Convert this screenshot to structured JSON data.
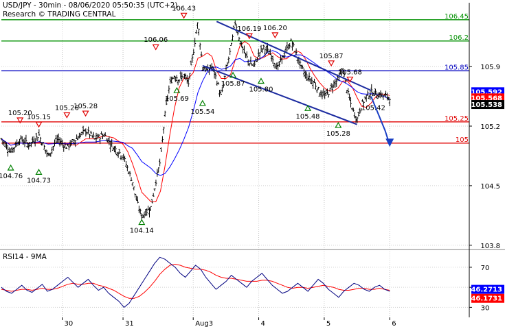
{
  "header": {
    "line1": "USD/JPY - 30min - 08/06/2020 05:50:35 (UTC+2)",
    "line2": "Research © TRADING CENTRAL"
  },
  "colors": {
    "support": "#e00000",
    "resistance": "#009000",
    "pivot": "#0000c0",
    "channel": "#1c2ba0",
    "forecast": "#1a3fc4",
    "ma_fast": "#ff0000",
    "ma_slow": "#0000ff",
    "rsi_line": "#000080",
    "rsi_ma": "#ff0000",
    "up_marker": "#008000",
    "down_marker": "#e00000"
  },
  "chart_data": [
    {
      "type": "candlestick",
      "title": "USD/JPY - 30min - 08/06/2020 05:50:35 (UTC+2)",
      "ylim": [
        103.75,
        106.65
      ],
      "y_ticks": [
        "106.45",
        "106.2",
        "105.9",
        "105.85",
        "105.592",
        "105.568",
        "105.538",
        "105.2",
        "105.25",
        "105",
        "104.5",
        "103.8"
      ],
      "x_ticks": [
        "30",
        "31",
        "Aug3",
        "4",
        "5",
        "6"
      ],
      "x_tick_positions": [
        0.13,
        0.26,
        0.41,
        0.55,
        0.69,
        0.83
      ],
      "levels": [
        {
          "value": 106.45,
          "label": "106.45",
          "role": "resistance"
        },
        {
          "value": 106.2,
          "label": "106.2",
          "role": "resistance"
        },
        {
          "value": 105.85,
          "label": "105.85",
          "role": "pivot"
        },
        {
          "value": 105.25,
          "label": "105.25",
          "role": "support"
        },
        {
          "value": 105,
          "label": "105",
          "role": "support"
        }
      ],
      "last_price_boxes": [
        {
          "value": 105.592,
          "label": "105.592",
          "color": "#0000ff"
        },
        {
          "value": 105.568,
          "label": "105.568",
          "color": "#ff0000"
        },
        {
          "value": 105.538,
          "label": "105.538",
          "color": "#000000"
        }
      ],
      "price_series": [
        [
          0.0,
          105.05
        ],
        [
          0.02,
          104.9
        ],
        [
          0.04,
          105.05
        ],
        [
          0.06,
          104.98
        ],
        [
          0.08,
          105.1
        ],
        [
          0.1,
          104.85
        ],
        [
          0.12,
          105.05
        ],
        [
          0.14,
          104.95
        ],
        [
          0.16,
          105.05
        ],
        [
          0.18,
          105.15
        ],
        [
          0.2,
          105.05
        ],
        [
          0.22,
          105.1
        ],
        [
          0.24,
          104.95
        ],
        [
          0.26,
          104.85
        ],
        [
          0.27,
          104.7
        ],
        [
          0.28,
          104.55
        ],
        [
          0.29,
          104.3
        ],
        [
          0.3,
          104.14
        ],
        [
          0.32,
          104.25
        ],
        [
          0.33,
          104.55
        ],
        [
          0.34,
          104.8
        ],
        [
          0.35,
          105.35
        ],
        [
          0.36,
          105.7
        ],
        [
          0.37,
          105.8
        ],
        [
          0.38,
          105.75
        ],
        [
          0.39,
          105.8
        ],
        [
          0.4,
          105.7
        ],
        [
          0.41,
          106.06
        ],
        [
          0.42,
          106.43
        ],
        [
          0.43,
          105.9
        ],
        [
          0.44,
          105.85
        ],
        [
          0.45,
          105.9
        ],
        [
          0.46,
          105.75
        ],
        [
          0.47,
          105.54
        ],
        [
          0.48,
          105.85
        ],
        [
          0.49,
          106.1
        ],
        [
          0.5,
          106.43
        ],
        [
          0.51,
          106.2
        ],
        [
          0.52,
          106.05
        ],
        [
          0.53,
          105.95
        ],
        [
          0.54,
          105.9
        ],
        [
          0.55,
          106.05
        ],
        [
          0.56,
          106.12
        ],
        [
          0.57,
          106.08
        ],
        [
          0.58,
          106.0
        ],
        [
          0.59,
          105.87
        ],
        [
          0.6,
          106.0
        ],
        [
          0.61,
          106.1
        ],
        [
          0.62,
          106.2
        ],
        [
          0.63,
          106.05
        ],
        [
          0.64,
          105.9
        ],
        [
          0.65,
          105.8
        ],
        [
          0.66,
          105.75
        ],
        [
          0.67,
          105.7
        ],
        [
          0.68,
          105.6
        ],
        [
          0.69,
          105.55
        ],
        [
          0.7,
          105.6
        ],
        [
          0.71,
          105.7
        ],
        [
          0.72,
          105.75
        ],
        [
          0.73,
          105.87
        ],
        [
          0.74,
          105.6
        ],
        [
          0.75,
          105.4
        ],
        [
          0.76,
          105.28
        ],
        [
          0.77,
          105.45
        ],
        [
          0.78,
          105.55
        ],
        [
          0.79,
          105.6
        ],
        [
          0.8,
          105.58
        ],
        [
          0.81,
          105.57
        ],
        [
          0.82,
          105.55
        ],
        [
          0.83,
          105.54
        ]
      ],
      "annotations": [
        {
          "x": 0.3,
          "y": 104.14,
          "label": "104.14",
          "dir": "up"
        },
        {
          "x": 0.02,
          "y": 104.78,
          "label": "104.76",
          "dir": "up"
        },
        {
          "x": 0.08,
          "y": 104.73,
          "label": "104.73",
          "dir": "up"
        },
        {
          "x": 0.04,
          "y": 105.2,
          "label": "105.20",
          "dir": "down"
        },
        {
          "x": 0.08,
          "y": 105.15,
          "label": "105.15",
          "dir": "down"
        },
        {
          "x": 0.14,
          "y": 105.26,
          "label": "105.26",
          "dir": "down"
        },
        {
          "x": 0.18,
          "y": 105.28,
          "label": "105.28",
          "dir": "down"
        },
        {
          "x": 0.33,
          "y": 106.06,
          "label": "106.06",
          "dir": "down"
        },
        {
          "x": 0.39,
          "y": 106.43,
          "label": "106.43",
          "dir": "down"
        },
        {
          "x": 0.375,
          "y": 105.69,
          "label": "105.69",
          "dir": "up"
        },
        {
          "x": 0.43,
          "y": 105.54,
          "label": "105.54",
          "dir": "up"
        },
        {
          "x": 0.495,
          "y": 105.87,
          "label": "105.87",
          "dir": "up"
        },
        {
          "x": 0.53,
          "y": 106.19,
          "label": "106.19",
          "dir": "down"
        },
        {
          "x": 0.555,
          "y": 105.8,
          "label": "105.80",
          "dir": "up"
        },
        {
          "x": 0.585,
          "y": 106.2,
          "label": "106.20",
          "dir": "down"
        },
        {
          "x": 0.655,
          "y": 105.48,
          "label": "105.48",
          "dir": "up"
        },
        {
          "x": 0.705,
          "y": 105.87,
          "label": "105.87",
          "dir": "down"
        },
        {
          "x": 0.72,
          "y": 105.28,
          "label": "105.28",
          "dir": "up"
        },
        {
          "x": 0.745,
          "y": 105.68,
          "label": "105.68",
          "dir": "down"
        },
        {
          "x": 0.795,
          "y": 105.42,
          "label": "105.42",
          "dir": "none"
        }
      ],
      "channel": {
        "upper": [
          [
            0.46,
            106.43
          ],
          [
            0.79,
            105.62
          ]
        ],
        "lower": [
          [
            0.43,
            105.91
          ],
          [
            0.76,
            105.22
          ]
        ]
      },
      "forecast": [
        [
          0.79,
          105.55
        ],
        [
          0.805,
          105.35
        ],
        [
          0.82,
          105.15
        ],
        [
          0.83,
          104.98
        ]
      ]
    },
    {
      "type": "line",
      "title": "RSI14 - 9MA",
      "ylim": [
        20,
        85
      ],
      "y_ticks": [
        "70",
        "50",
        "30"
      ],
      "last_values": [
        {
          "value": 46.2713,
          "label": "46.2713",
          "color": "#0000ff"
        },
        {
          "value": 46.1731,
          "label": "46.1731",
          "color": "#ff0000"
        }
      ],
      "series": [
        {
          "values": [
            50,
            46,
            44,
            48,
            52,
            47,
            45,
            49,
            53,
            46,
            48,
            52,
            56,
            60,
            55,
            50,
            54,
            58,
            52,
            47,
            50,
            44,
            40,
            36,
            30,
            34,
            42,
            50,
            58,
            66,
            74,
            80,
            78,
            74,
            70,
            64,
            60,
            66,
            72,
            68,
            60,
            54,
            48,
            52,
            56,
            62,
            58,
            54,
            50,
            56,
            60,
            64,
            58,
            52,
            48,
            44,
            46,
            50,
            54,
            50,
            46,
            52,
            58,
            54,
            48,
            44,
            40,
            46,
            50,
            54,
            52,
            48,
            46,
            50,
            52,
            48,
            46
          ]
        },
        {
          "values": [
            48,
            47,
            46,
            47,
            48,
            48,
            47,
            48,
            49,
            48,
            48,
            49,
            51,
            53,
            54,
            53,
            53,
            54,
            54,
            52,
            51,
            49,
            47,
            44,
            41,
            39,
            39,
            41,
            45,
            50,
            56,
            63,
            68,
            72,
            73,
            72,
            70,
            69,
            68,
            68,
            67,
            65,
            62,
            60,
            59,
            59,
            58,
            57,
            56,
            56,
            56,
            57,
            57,
            56,
            54,
            52,
            50,
            49,
            50,
            50,
            49,
            50,
            51,
            52,
            51,
            50,
            48,
            47,
            47,
            48,
            49,
            49,
            48,
            48,
            49,
            48,
            47
          ]
        }
      ]
    }
  ]
}
